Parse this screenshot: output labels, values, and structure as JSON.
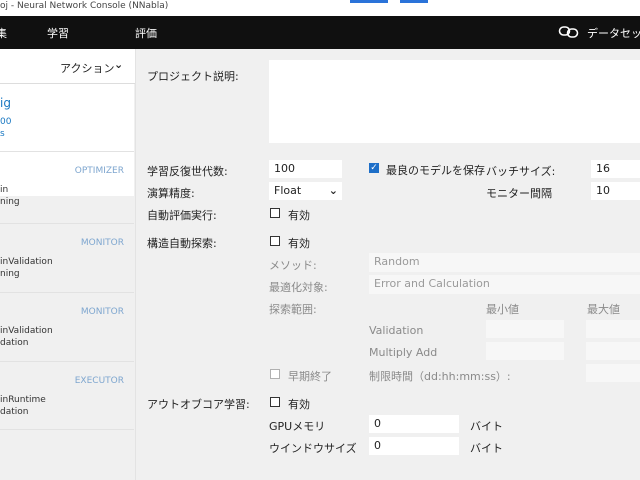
{
  "window": {
    "title": "oj - Neural Network Console (NNabla)"
  },
  "topnav": {
    "tabs": [
      {
        "label": "集"
      },
      {
        "label": "学習"
      },
      {
        "label": "評価"
      }
    ],
    "dataset": "データセット"
  },
  "sidebar": {
    "action_label": "アクション",
    "config": {
      "name": "ig",
      "line1": "00",
      "line2": "s"
    },
    "sections": [
      {
        "type": "OPTIMIZER",
        "line1": "in",
        "line2": "ning"
      },
      {
        "type": "MONITOR",
        "line1": "inValidation",
        "line2": "ning"
      },
      {
        "type": "MONITOR",
        "line1": "inValidation",
        "line2": "dation"
      },
      {
        "type": "EXECUTOR",
        "line1": "inRuntime",
        "line2": "dation"
      }
    ]
  },
  "form": {
    "project_desc_label": "プロジェクト説明:",
    "epochs_label": "学習反復世代数:",
    "epochs_value": "100",
    "save_best_label": "最良のモデルを保存",
    "batch_size_label": "バッチサイズ:",
    "batch_size_value": "16",
    "precision_label": "演算精度:",
    "precision_value": "Float",
    "monitor_interval_label": "モニター間隔",
    "monitor_interval_value": "10",
    "auto_eval_label": "自動評価実行:",
    "enabled_label": "有効",
    "auto_search_label": "構造自動探索:",
    "method_label": "メソッド:",
    "method_value": "Random",
    "target_label": "最適化対象:",
    "target_value": "Error and Calculation",
    "range_label": "探索範囲:",
    "min_label": "最小値",
    "max_label": "最大値",
    "validation_label": "Validation",
    "multiply_add_label": "Multiply Add",
    "early_stop_label": "早期終了",
    "time_limit_label": "制限時間（dd:hh:mm:ss）:",
    "out_of_core_label": "アウトオブコア学習:",
    "gpu_memory_label": "GPUメモリ",
    "gpu_memory_value": "0",
    "window_size_label": "ウインドウサイズ",
    "window_size_value": "0",
    "byte_unit": "バイト"
  },
  "colors": {
    "accent": "#1e6fc8",
    "nav_bg": "#101010",
    "sidebar_type": "#7ea6cf",
    "link": "#1a78c2"
  },
  "icons": {
    "dataset": "link-icon",
    "action_dropdown": "chevron-down-icon",
    "precision_dropdown": "chevron-down-icon"
  }
}
